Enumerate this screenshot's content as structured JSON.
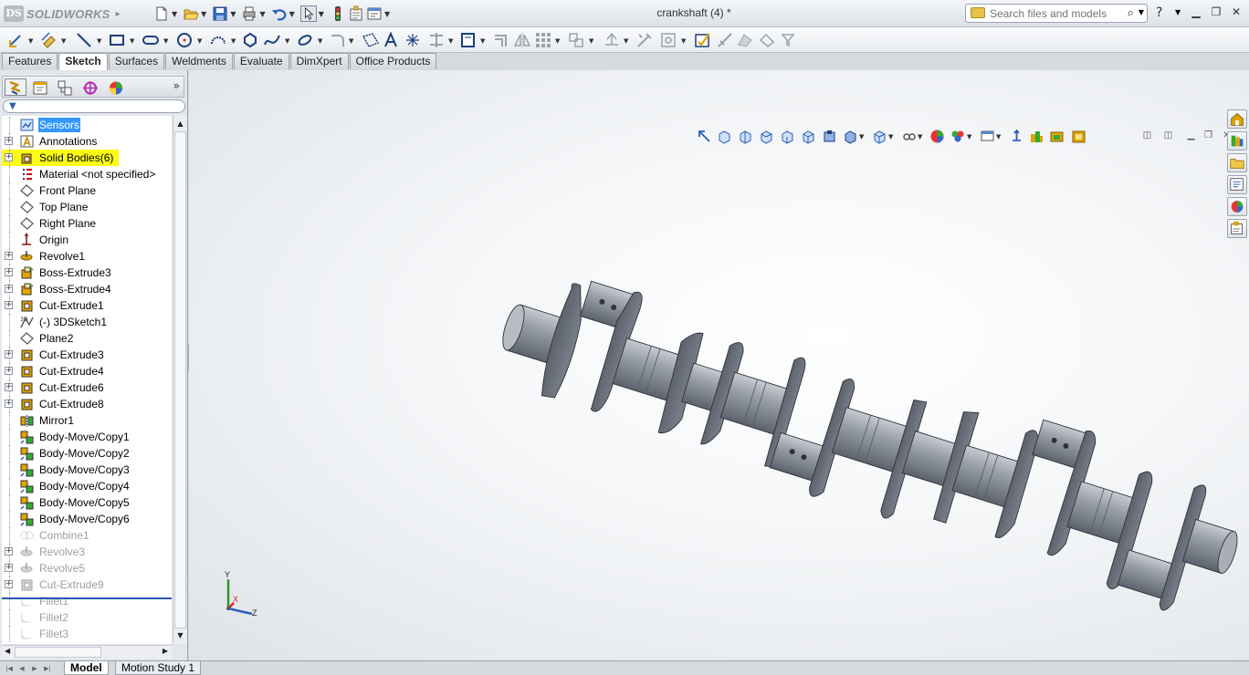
{
  "app": {
    "brand": "SOLIDWORKS",
    "doc_title": "crankshaft (4) *"
  },
  "search": {
    "placeholder": "Search files and models"
  },
  "help": {
    "label": "?"
  },
  "command_tabs": [
    {
      "label": "Features",
      "active": false
    },
    {
      "label": "Sketch",
      "active": true
    },
    {
      "label": "Surfaces",
      "active": false
    },
    {
      "label": "Weldments",
      "active": false
    },
    {
      "label": "Evaluate",
      "active": false
    },
    {
      "label": "DimXpert",
      "active": false
    },
    {
      "label": "Office Products",
      "active": false
    }
  ],
  "tree": [
    {
      "label": "Sensors",
      "icon": "sensors-icon",
      "expand": false,
      "state": "selected"
    },
    {
      "label": "Annotations",
      "icon": "annotations-icon",
      "expand": true,
      "state": "normal"
    },
    {
      "label": "Solid Bodies(6)",
      "icon": "solid-bodies-icon",
      "expand": true,
      "state": "highlighted"
    },
    {
      "label": "Material <not specified>",
      "icon": "material-icon",
      "expand": false,
      "state": "normal"
    },
    {
      "label": "Front Plane",
      "icon": "plane-icon",
      "expand": false,
      "state": "normal"
    },
    {
      "label": "Top Plane",
      "icon": "plane-icon",
      "expand": false,
      "state": "normal"
    },
    {
      "label": "Right Plane",
      "icon": "plane-icon",
      "expand": false,
      "state": "normal"
    },
    {
      "label": "Origin",
      "icon": "origin-icon",
      "expand": false,
      "state": "normal"
    },
    {
      "label": "Revolve1",
      "icon": "revolve-icon",
      "expand": true,
      "state": "normal"
    },
    {
      "label": "Boss-Extrude3",
      "icon": "boss-extrude-icon",
      "expand": true,
      "state": "normal"
    },
    {
      "label": "Boss-Extrude4",
      "icon": "boss-extrude-icon",
      "expand": true,
      "state": "normal"
    },
    {
      "label": "Cut-Extrude1",
      "icon": "cut-extrude-icon",
      "expand": true,
      "state": "normal"
    },
    {
      "label": "(-) 3DSketch1",
      "icon": "3dsketch-icon",
      "expand": false,
      "state": "normal"
    },
    {
      "label": "Plane2",
      "icon": "plane-icon",
      "expand": false,
      "state": "normal"
    },
    {
      "label": "Cut-Extrude3",
      "icon": "cut-extrude-icon",
      "expand": true,
      "state": "normal"
    },
    {
      "label": "Cut-Extrude4",
      "icon": "cut-extrude-icon",
      "expand": true,
      "state": "normal"
    },
    {
      "label": "Cut-Extrude6",
      "icon": "cut-extrude-icon",
      "expand": true,
      "state": "normal"
    },
    {
      "label": "Cut-Extrude8",
      "icon": "cut-extrude-icon",
      "expand": true,
      "state": "normal"
    },
    {
      "label": "Mirror1",
      "icon": "mirror-icon",
      "expand": false,
      "state": "normal"
    },
    {
      "label": "Body-Move/Copy1",
      "icon": "body-move-icon",
      "expand": false,
      "state": "normal"
    },
    {
      "label": "Body-Move/Copy2",
      "icon": "body-move-icon",
      "expand": false,
      "state": "normal"
    },
    {
      "label": "Body-Move/Copy3",
      "icon": "body-move-icon",
      "expand": false,
      "state": "normal"
    },
    {
      "label": "Body-Move/Copy4",
      "icon": "body-move-icon",
      "expand": false,
      "state": "normal"
    },
    {
      "label": "Body-Move/Copy5",
      "icon": "body-move-icon",
      "expand": false,
      "state": "normal"
    },
    {
      "label": "Body-Move/Copy6",
      "icon": "body-move-icon",
      "expand": false,
      "state": "normal"
    },
    {
      "label": "Combine1",
      "icon": "combine-icon",
      "expand": false,
      "state": "suppressed"
    },
    {
      "label": "Revolve3",
      "icon": "revolve-icon",
      "expand": true,
      "state": "suppressed"
    },
    {
      "label": "Revolve5",
      "icon": "revolve-icon",
      "expand": true,
      "state": "suppressed"
    },
    {
      "label": "Cut-Extrude9",
      "icon": "cut-extrude-icon",
      "expand": true,
      "state": "suppressed"
    },
    {
      "label": "Fillet1",
      "icon": "fillet-icon",
      "expand": false,
      "state": "suppressed"
    },
    {
      "label": "Fillet2",
      "icon": "fillet-icon",
      "expand": false,
      "state": "suppressed"
    },
    {
      "label": "Fillet3",
      "icon": "fillet-icon",
      "expand": false,
      "state": "suppressed"
    }
  ],
  "triad": {
    "x": "X",
    "y": "Y",
    "z": "Z"
  },
  "bottom_tabs": [
    {
      "label": "Model",
      "active": true
    },
    {
      "label": "Motion Study 1",
      "active": false
    }
  ],
  "colors": {
    "selection": "#3399ff",
    "highlight": "#fbfb16",
    "part_steel": "#8a9098"
  }
}
